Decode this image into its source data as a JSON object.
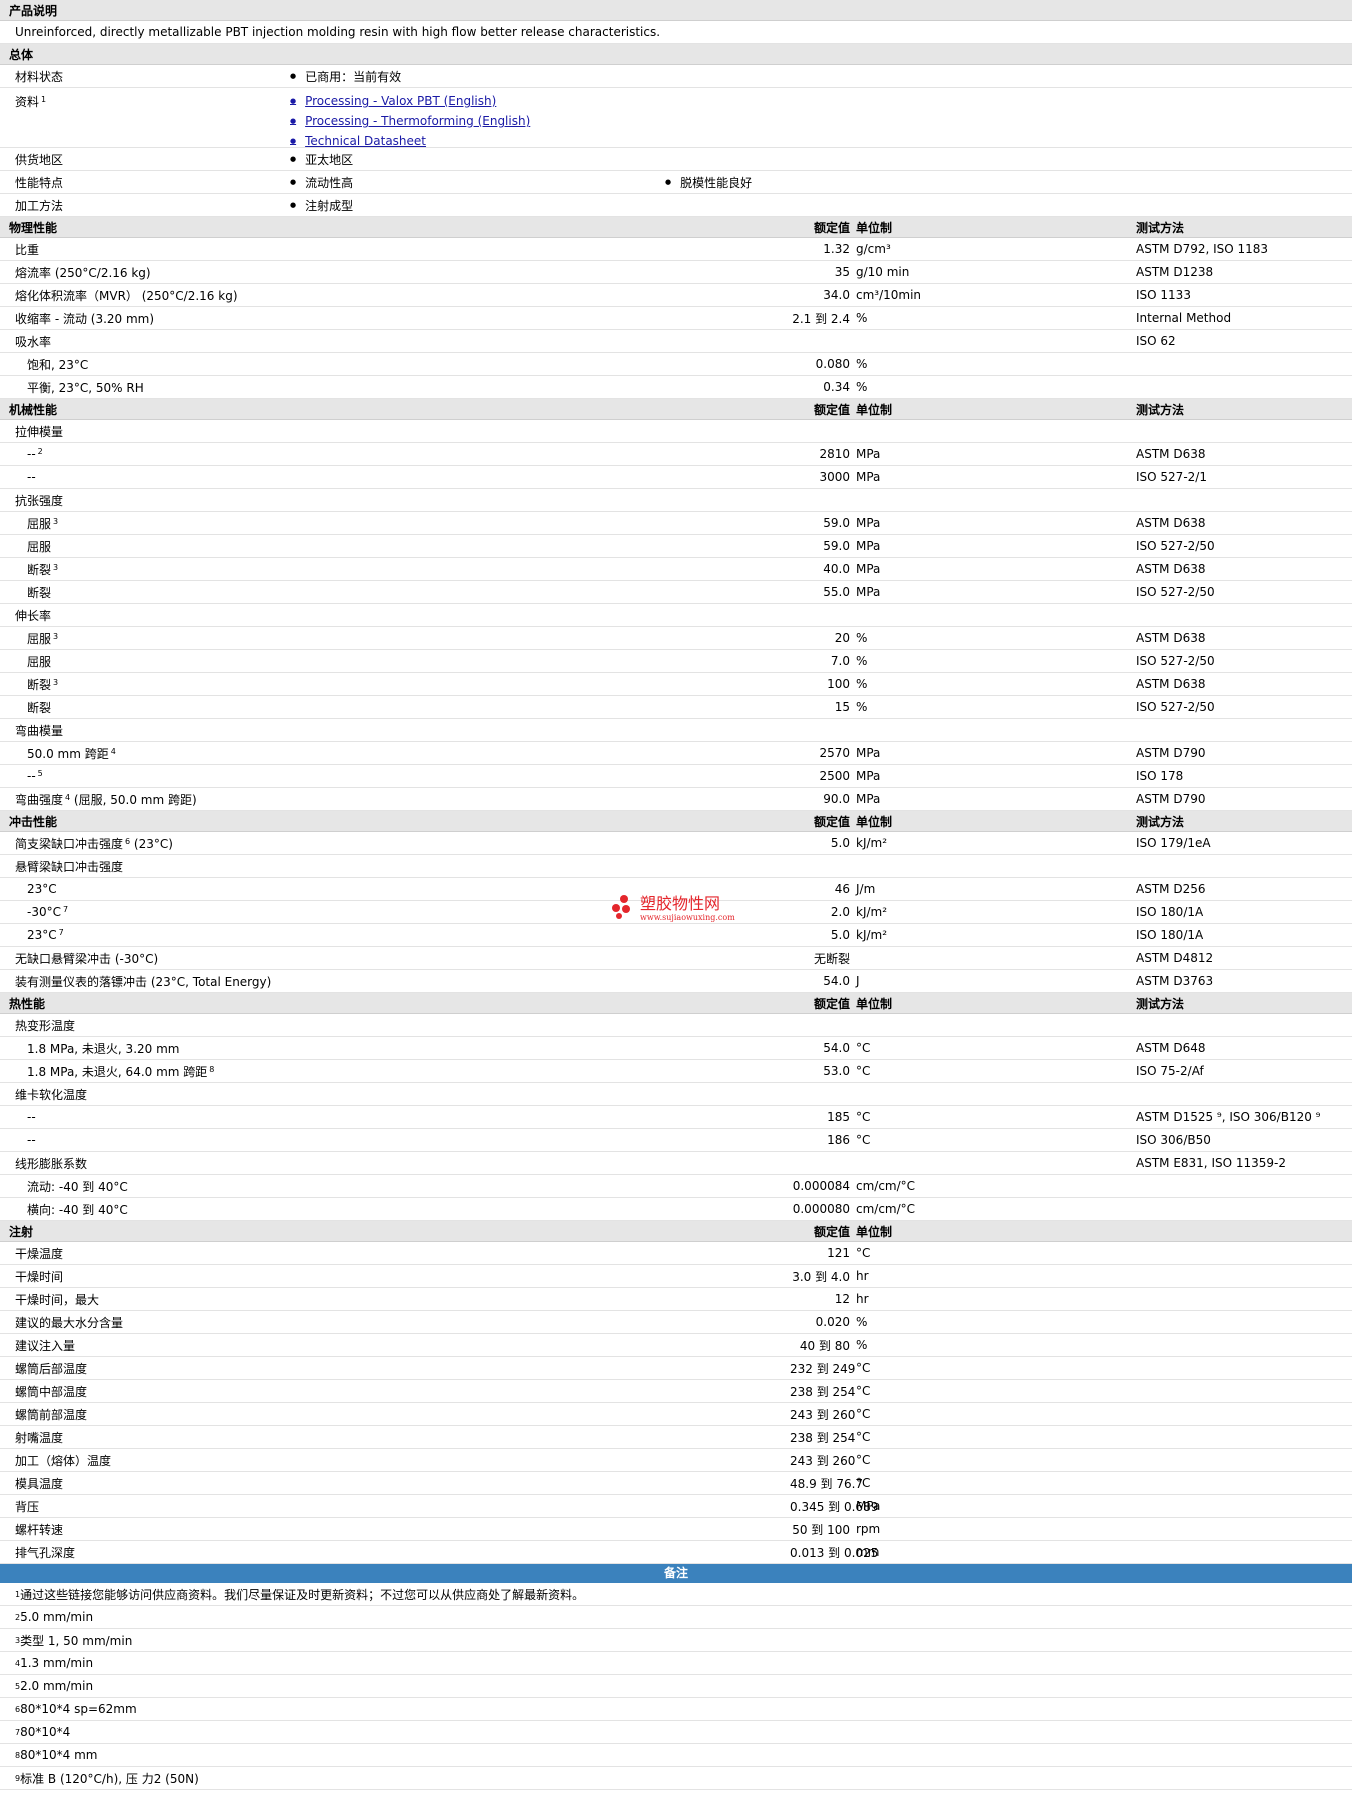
{
  "product_description": {
    "title": "产品说明",
    "text": "Unreinforced, directly metallizable PBT injection molding resin with high flow better release characteristics."
  },
  "general": {
    "title": "总体",
    "material_status": {
      "label": "材料状态",
      "value": "已商用：当前有效"
    },
    "literature": {
      "label": "资料",
      "sup": "1",
      "links": [
        "Processing - Valox PBT (English)",
        "Processing - Thermoforming (English)",
        "Technical Datasheet"
      ]
    },
    "availability": {
      "label": "供货地区",
      "value": "亚太地区"
    },
    "features": {
      "label": "性能特点",
      "values": [
        "流动性高",
        "脱模性能良好"
      ]
    },
    "processing": {
      "label": "加工方法",
      "value": "注射成型"
    }
  },
  "columns": {
    "nominal": "额定值",
    "unit": "单位制",
    "test": "测试方法"
  },
  "sections": [
    {
      "title": "物理性能",
      "show_test": true,
      "rows": [
        {
          "name": "比重",
          "value": "1.32",
          "unit": "g/cm³",
          "test": "ASTM D792, ISO 1183"
        },
        {
          "name": "熔流率  (250°C/2.16 kg)",
          "value": "35",
          "unit": "g/10 min",
          "test": "ASTM D1238"
        },
        {
          "name": "熔化体积流率（MVR） (250°C/2.16 kg)",
          "value": "34.0",
          "unit": "cm³/10min",
          "test": "ISO 1133"
        },
        {
          "name": "收缩率  - 流动  (3.20 mm)",
          "value": "2.1 到  2.4",
          "unit": "%",
          "test": "Internal Method"
        },
        {
          "name": "吸水率",
          "value": "",
          "unit": "",
          "test": "ISO 62"
        },
        {
          "name": "饱和, 23°C",
          "sub": true,
          "value": "0.080",
          "unit": "%",
          "test": ""
        },
        {
          "name": "平衡, 23°C, 50% RH",
          "sub": true,
          "value": "0.34",
          "unit": "%",
          "test": ""
        }
      ]
    },
    {
      "title": "机械性能",
      "show_test": true,
      "rows": [
        {
          "name": "拉伸模量",
          "value": "",
          "unit": "",
          "test": ""
        },
        {
          "name": "--",
          "sup": "2",
          "sub": true,
          "value": "2810",
          "unit": "MPa",
          "test": "ASTM D638"
        },
        {
          "name": "--",
          "sub": true,
          "value": "3000",
          "unit": "MPa",
          "test": "ISO 527-2/1"
        },
        {
          "name": "抗张强度",
          "value": "",
          "unit": "",
          "test": ""
        },
        {
          "name": "屈服",
          "sup": "3",
          "sub": true,
          "value": "59.0",
          "unit": "MPa",
          "test": "ASTM D638"
        },
        {
          "name": "屈服",
          "sub": true,
          "value": "59.0",
          "unit": "MPa",
          "test": "ISO 527-2/50"
        },
        {
          "name": "断裂",
          "sup": "3",
          "sub": true,
          "value": "40.0",
          "unit": "MPa",
          "test": "ASTM D638"
        },
        {
          "name": "断裂",
          "sub": true,
          "value": "55.0",
          "unit": "MPa",
          "test": "ISO 527-2/50"
        },
        {
          "name": "伸长率",
          "value": "",
          "unit": "",
          "test": ""
        },
        {
          "name": "屈服",
          "sup": "3",
          "sub": true,
          "value": "20",
          "unit": "%",
          "test": "ASTM D638"
        },
        {
          "name": "屈服",
          "sub": true,
          "value": "7.0",
          "unit": "%",
          "test": "ISO 527-2/50"
        },
        {
          "name": "断裂",
          "sup": "3",
          "sub": true,
          "value": "100",
          "unit": "%",
          "test": "ASTM D638"
        },
        {
          "name": "断裂",
          "sub": true,
          "value": "15",
          "unit": "%",
          "test": "ISO 527-2/50"
        },
        {
          "name": "弯曲模量",
          "value": "",
          "unit": "",
          "test": ""
        },
        {
          "name": "50.0 mm 跨距",
          "sup": "4",
          "sub": true,
          "value": "2570",
          "unit": "MPa",
          "test": "ASTM D790"
        },
        {
          "name": "--",
          "sup": "5",
          "sub": true,
          "value": "2500",
          "unit": "MPa",
          "test": "ISO 178"
        },
        {
          "name": "弯曲强度",
          "sup": "4",
          "suffix": " (屈服, 50.0 mm 跨距)",
          "value": "90.0",
          "unit": "MPa",
          "test": "ASTM D790"
        }
      ]
    },
    {
      "title": "冲击性能",
      "show_test": true,
      "rows": [
        {
          "name": "简支梁缺口冲击强度",
          "sup": "6",
          "suffix": " (23°C)",
          "value": "5.0",
          "unit": "kJ/m²",
          "test": "ISO 179/1eA"
        },
        {
          "name": "悬臂梁缺口冲击强度",
          "value": "",
          "unit": "",
          "test": ""
        },
        {
          "name": "23°C",
          "sub": true,
          "value": "46",
          "unit": "J/m",
          "test": "ASTM D256"
        },
        {
          "name": "-30°C",
          "sup": "7",
          "sub": true,
          "value": "2.0",
          "unit": "kJ/m²",
          "test": "ISO 180/1A"
        },
        {
          "name": "23°C",
          "sup": "7",
          "sub": true,
          "value": "5.0",
          "unit": "kJ/m²",
          "test": "ISO 180/1A"
        },
        {
          "name": "无缺口悬臂梁冲击  (-30°C)",
          "value": "无断裂",
          "unit": "",
          "test": "ASTM D4812"
        },
        {
          "name": "装有测量仪表的落镖冲击  (23°C, Total Energy)",
          "value": "54.0",
          "unit": "J",
          "test": "ASTM D3763"
        }
      ]
    },
    {
      "title": "热性能",
      "show_test": true,
      "rows": [
        {
          "name": "热变形温度",
          "value": "",
          "unit": "",
          "test": ""
        },
        {
          "name": "1.8 MPa, 未退火, 3.20 mm",
          "sub": true,
          "value": "54.0",
          "unit": "°C",
          "test": "ASTM D648"
        },
        {
          "name": "1.8 MPa, 未退火, 64.0 mm 跨距",
          "sup": "8",
          "sub": true,
          "value": "53.0",
          "unit": "°C",
          "test": "ISO 75-2/Af"
        },
        {
          "name": "维卡软化温度",
          "value": "",
          "unit": "",
          "test": ""
        },
        {
          "name": "--",
          "sub": true,
          "value": "185",
          "unit": "°C",
          "test": "ASTM D1525 ⁹, ISO 306/B120 ⁹"
        },
        {
          "name": "--",
          "sub": true,
          "value": "186",
          "unit": "°C",
          "test": "ISO 306/B50"
        },
        {
          "name": "线形膨胀系数",
          "value": "",
          "unit": "",
          "test": "ASTM E831, ISO 11359-2"
        },
        {
          "name": "流动: -40 到  40°C",
          "sub": true,
          "value": "0.000084",
          "unit": "cm/cm/°C",
          "test": ""
        },
        {
          "name": "横向: -40 到  40°C",
          "sub": true,
          "value": "0.000080",
          "unit": "cm/cm/°C",
          "test": ""
        }
      ]
    },
    {
      "title": "注射",
      "show_test": false,
      "rows": [
        {
          "name": "干燥温度",
          "value": "121",
          "unit": "°C",
          "test": ""
        },
        {
          "name": "干燥时间",
          "value": "3.0 到  4.0",
          "unit": "hr",
          "test": ""
        },
        {
          "name": "干燥时间，最大",
          "value": "12",
          "unit": "hr",
          "test": ""
        },
        {
          "name": "建议的最大水分含量",
          "value": "0.020",
          "unit": "%",
          "test": ""
        },
        {
          "name": "建议注入量",
          "value": "40 到  80",
          "unit": "%",
          "test": ""
        },
        {
          "name": "螺筒后部温度",
          "value": "232 到  249",
          "unit": "°C",
          "test": ""
        },
        {
          "name": "螺筒中部温度",
          "value": "238 到  254",
          "unit": "°C",
          "test": ""
        },
        {
          "name": "螺筒前部温度",
          "value": "243 到  260",
          "unit": "°C",
          "test": ""
        },
        {
          "name": "射嘴温度",
          "value": "238 到  254",
          "unit": "°C",
          "test": ""
        },
        {
          "name": "加工（熔体）温度",
          "value": "243 到  260",
          "unit": "°C",
          "test": ""
        },
        {
          "name": "模具温度",
          "value": "48.9 到  76.7",
          "unit": "°C",
          "test": ""
        },
        {
          "name": "背压",
          "value": "0.345 到  0.689",
          "unit": "MPa",
          "test": ""
        },
        {
          "name": "螺杆转速",
          "value": "50 到  100",
          "unit": "rpm",
          "test": ""
        },
        {
          "name": "排气孔深度",
          "value": "0.013 到  0.025",
          "unit": "mm",
          "test": ""
        }
      ]
    }
  ],
  "notes": {
    "title": "备注",
    "items": [
      {
        "num": "1",
        "text": "通过这些链接您能够访问供应商资料。我们尽量保证及时更新资料；不过您可以从供应商处了解最新资料。"
      },
      {
        "num": "2",
        "text": "5.0 mm/min"
      },
      {
        "num": "3",
        "text": "类型  1, 50 mm/min"
      },
      {
        "num": "4",
        "text": "1.3 mm/min"
      },
      {
        "num": "5",
        "text": "2.0 mm/min"
      },
      {
        "num": "6",
        "text": "80*10*4 sp=62mm"
      },
      {
        "num": "7",
        "text": "80*10*4"
      },
      {
        "num": "8",
        "text": "80*10*4 mm"
      },
      {
        "num": "9",
        "text": "标准  B (120°C/h), 压  力2 (50N)"
      }
    ]
  },
  "watermark": {
    "name": "塑胶物性网",
    "url": "www.sujiaowuxing.com",
    "color": "#e4262c"
  }
}
